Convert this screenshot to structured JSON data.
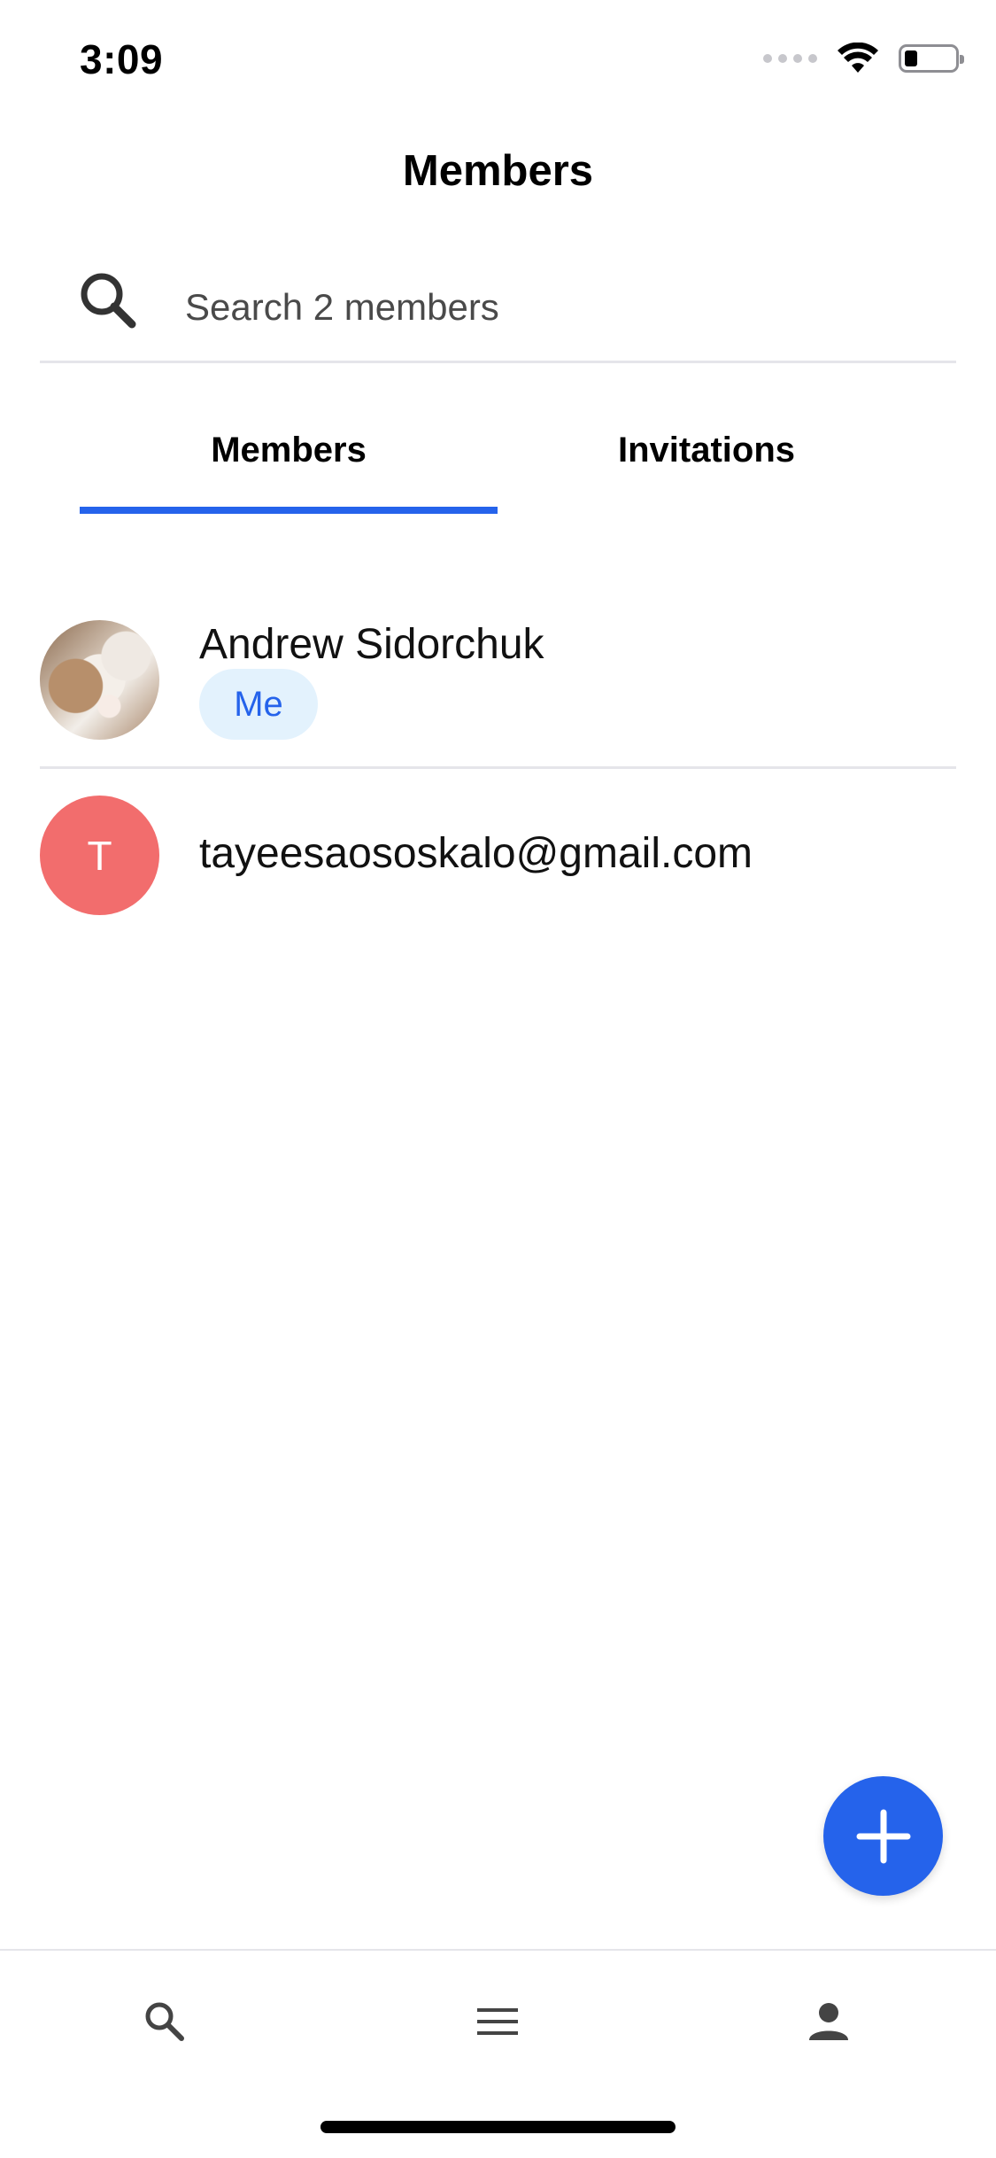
{
  "status_bar": {
    "time": "3:09",
    "icons": [
      "signal-dots-icon",
      "wifi-icon",
      "battery-icon"
    ]
  },
  "header": {
    "title": "Members"
  },
  "search": {
    "placeholder": "Search 2 members",
    "value": "",
    "icon": "search-icon"
  },
  "tabs": [
    {
      "label": "Members",
      "active": true
    },
    {
      "label": "Invitations",
      "active": false
    }
  ],
  "members": [
    {
      "name": "Andrew Sidorchuk",
      "badge": "Me",
      "avatar": "photo"
    },
    {
      "name": "tayeesaososkalo@gmail.com",
      "initial": "T",
      "avatar_color": "#f26d6d"
    }
  ],
  "fab": {
    "icon": "plus-icon"
  },
  "bottom_nav": [
    {
      "icon": "search-icon"
    },
    {
      "icon": "menu-icon"
    },
    {
      "icon": "person-icon"
    }
  ],
  "colors": {
    "accent": "#2563eb",
    "badge_bg": "#e3f2fd",
    "divider": "#e5e5ea"
  }
}
